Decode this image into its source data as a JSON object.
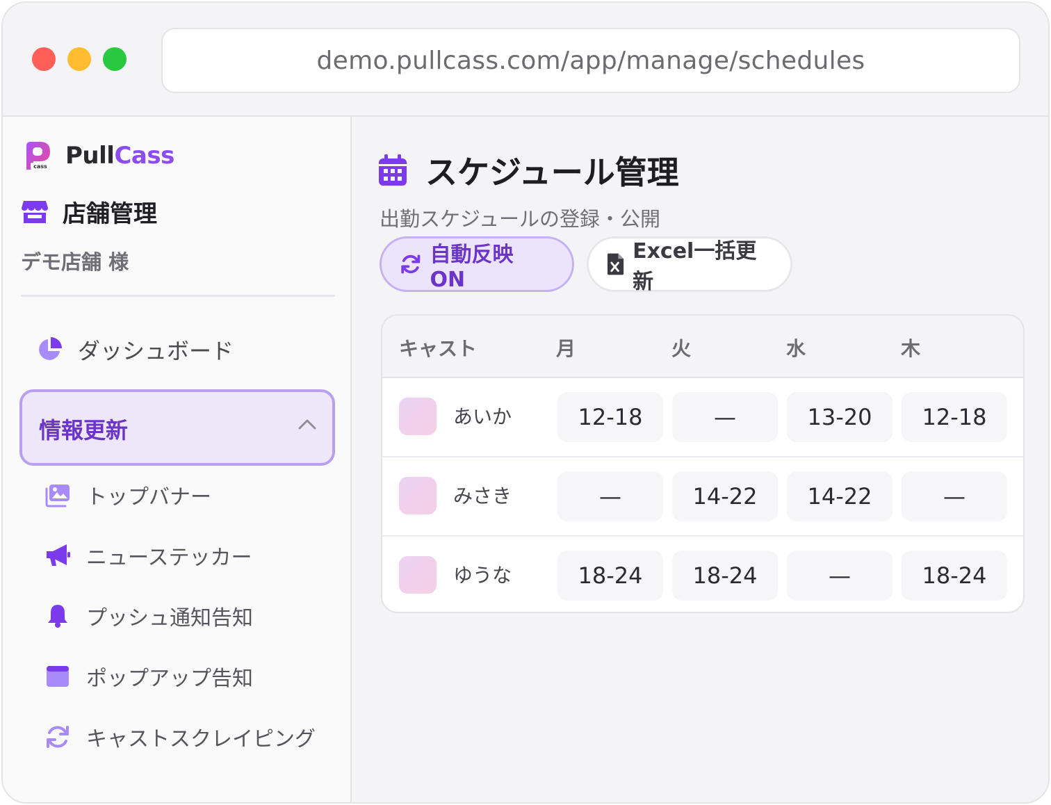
{
  "browser": {
    "url": "demo.pullcass.com/app/manage/schedules"
  },
  "sidebar": {
    "brand": {
      "pull": "Pull",
      "cass": "Cass",
      "logo_text": "cass"
    },
    "section_title": "店舗管理",
    "store_name": "デモ店舗 様",
    "dashboard_label": "ダッシュボード",
    "group_label": "情報更新",
    "sub_items": [
      {
        "label": "トップバナー",
        "icon": "image-icon"
      },
      {
        "label": "ニューステッカー",
        "icon": "megaphone-icon"
      },
      {
        "label": "プッシュ通知告知",
        "icon": "bell-icon"
      },
      {
        "label": "ポップアップ告知",
        "icon": "window-icon"
      },
      {
        "label": "キャストスクレイピング",
        "icon": "sync-icon"
      }
    ]
  },
  "main": {
    "title": "スケジュール管理",
    "subtitle": "出勤スケジュールの登録・公開",
    "auto_button": "自動反映 ON",
    "excel_button": "Excel一括更新",
    "table": {
      "headers": [
        "キャスト",
        "月",
        "火",
        "水",
        "木"
      ],
      "rows": [
        {
          "name": "あいか",
          "shifts": [
            "12-18",
            "—",
            "13-20",
            "12-18"
          ]
        },
        {
          "name": "みさき",
          "shifts": [
            "—",
            "14-22",
            "14-22",
            "—"
          ]
        },
        {
          "name": "ゆうな",
          "shifts": [
            "18-24",
            "18-24",
            "—",
            "18-24"
          ]
        }
      ]
    }
  },
  "colors": {
    "accent": "#7c3aed",
    "accent_light": "#ede7f9",
    "traffic_red": "#ff5f57",
    "traffic_yellow": "#febc2e",
    "traffic_green": "#28c840"
  }
}
